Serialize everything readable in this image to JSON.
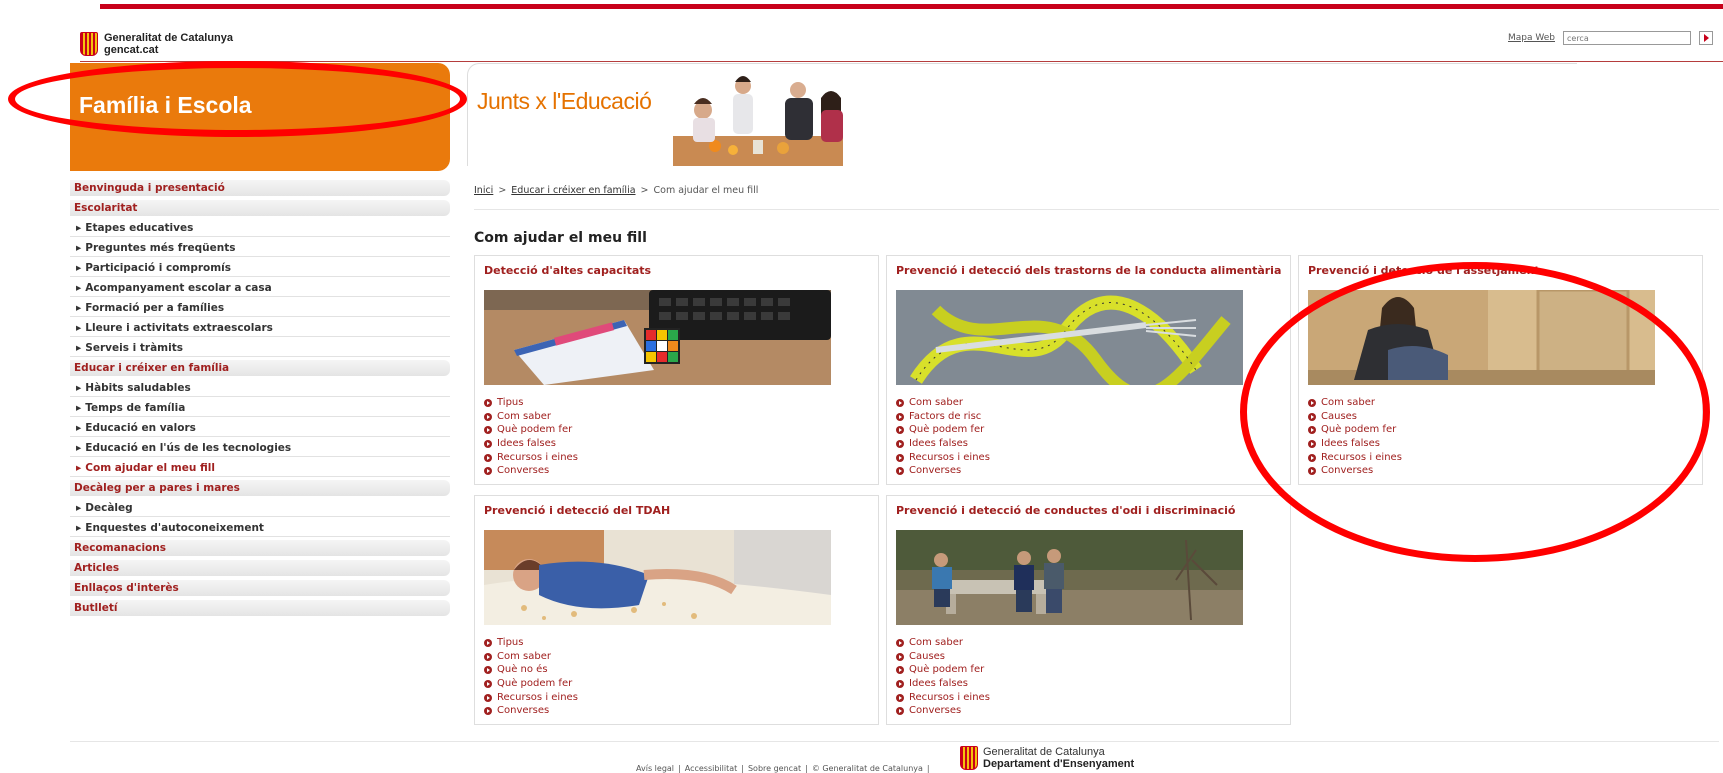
{
  "header": {
    "brand_line1": "Generalitat de Catalunya",
    "brand_line2": "gencat.cat",
    "mapa_web": "Mapa Web",
    "search_placeholder": "cerca"
  },
  "section_title": "Família i Escola",
  "banner": {
    "title": "Junts x l'Educació"
  },
  "sidebar": {
    "groups": [
      {
        "label": "Benvinguda i presentació",
        "items": []
      },
      {
        "label": "Escolaritat",
        "items": [
          "Etapes educatives",
          "Preguntes més freqüents",
          "Participació i compromís",
          "Acompanyament escolar a casa",
          "Formació per a famílies",
          "Lleure i activitats extraescolars",
          "Serveis i tràmits"
        ]
      },
      {
        "label": "Educar i créixer en família",
        "items": [
          "Hàbits saludables",
          "Temps de família",
          "Educació en valors",
          "Educació en l'ús de les tecnologies",
          "Com ajudar el meu fill"
        ]
      },
      {
        "label": "Decàleg per a pares i mares",
        "items": [
          "Decàleg",
          "Enquestes d'autoconeixement"
        ]
      },
      {
        "label": "Recomanacions",
        "items": []
      },
      {
        "label": "Articles",
        "items": []
      },
      {
        "label": "Enllaços d'interès",
        "items": []
      },
      {
        "label": "Butlletí",
        "items": []
      }
    ],
    "active_item": "Com ajudar el meu fill"
  },
  "breadcrumb": {
    "home": "Inici",
    "parent": "Educar i créixer en família",
    "current": "Com ajudar el meu fill",
    "separator": ">"
  },
  "page_title": "Com ajudar el meu fill",
  "cards": [
    {
      "title": "Detecció d'altes capacitats",
      "image": "desk-notebook-rubik-cube-photo",
      "links": [
        "Tipus",
        "Com saber",
        "Què podem fer",
        "Idees falses",
        "Recursos i eines",
        "Converses"
      ]
    },
    {
      "title": "Prevenció i detecció dels trastorns de la conducta alimentària",
      "image": "measuring-tape-fork-photo",
      "links": [
        "Com saber",
        "Factors de risc",
        "Què podem fer",
        "Idees falses",
        "Recursos i eines",
        "Converses"
      ]
    },
    {
      "title": "Prevenció i detecció de l'assetjament",
      "image": "sad-girl-sitting-photo",
      "links": [
        "Com saber",
        "Causes",
        "Què podem fer",
        "Idees falses",
        "Recursos i eines",
        "Converses"
      ]
    },
    {
      "title": "Prevenció i detecció del TDAH",
      "image": "child-lying-on-bed-photo",
      "links": [
        "Tipus",
        "Com saber",
        "Què no és",
        "Què podem fer",
        "Recursos i eines",
        "Converses"
      ]
    },
    {
      "title": "Prevenció i detecció de conductes d'odi i discriminació",
      "image": "teens-on-bench-photo",
      "links": [
        "Com saber",
        "Causes",
        "Què podem fer",
        "Idees falses",
        "Recursos i eines",
        "Converses"
      ]
    }
  ],
  "footer": {
    "links": [
      "Avís legal",
      "Accessibilitat",
      "Sobre gencat",
      "© Generalitat de Catalunya"
    ],
    "separator": "|",
    "brand_line1": "Generalitat de Catalunya",
    "brand_line2": "Departament d'Ensenyament"
  },
  "colors": {
    "accent_red": "#a0201f",
    "brand_orange": "#ea7a0c",
    "annotation_red": "#ff0000"
  }
}
